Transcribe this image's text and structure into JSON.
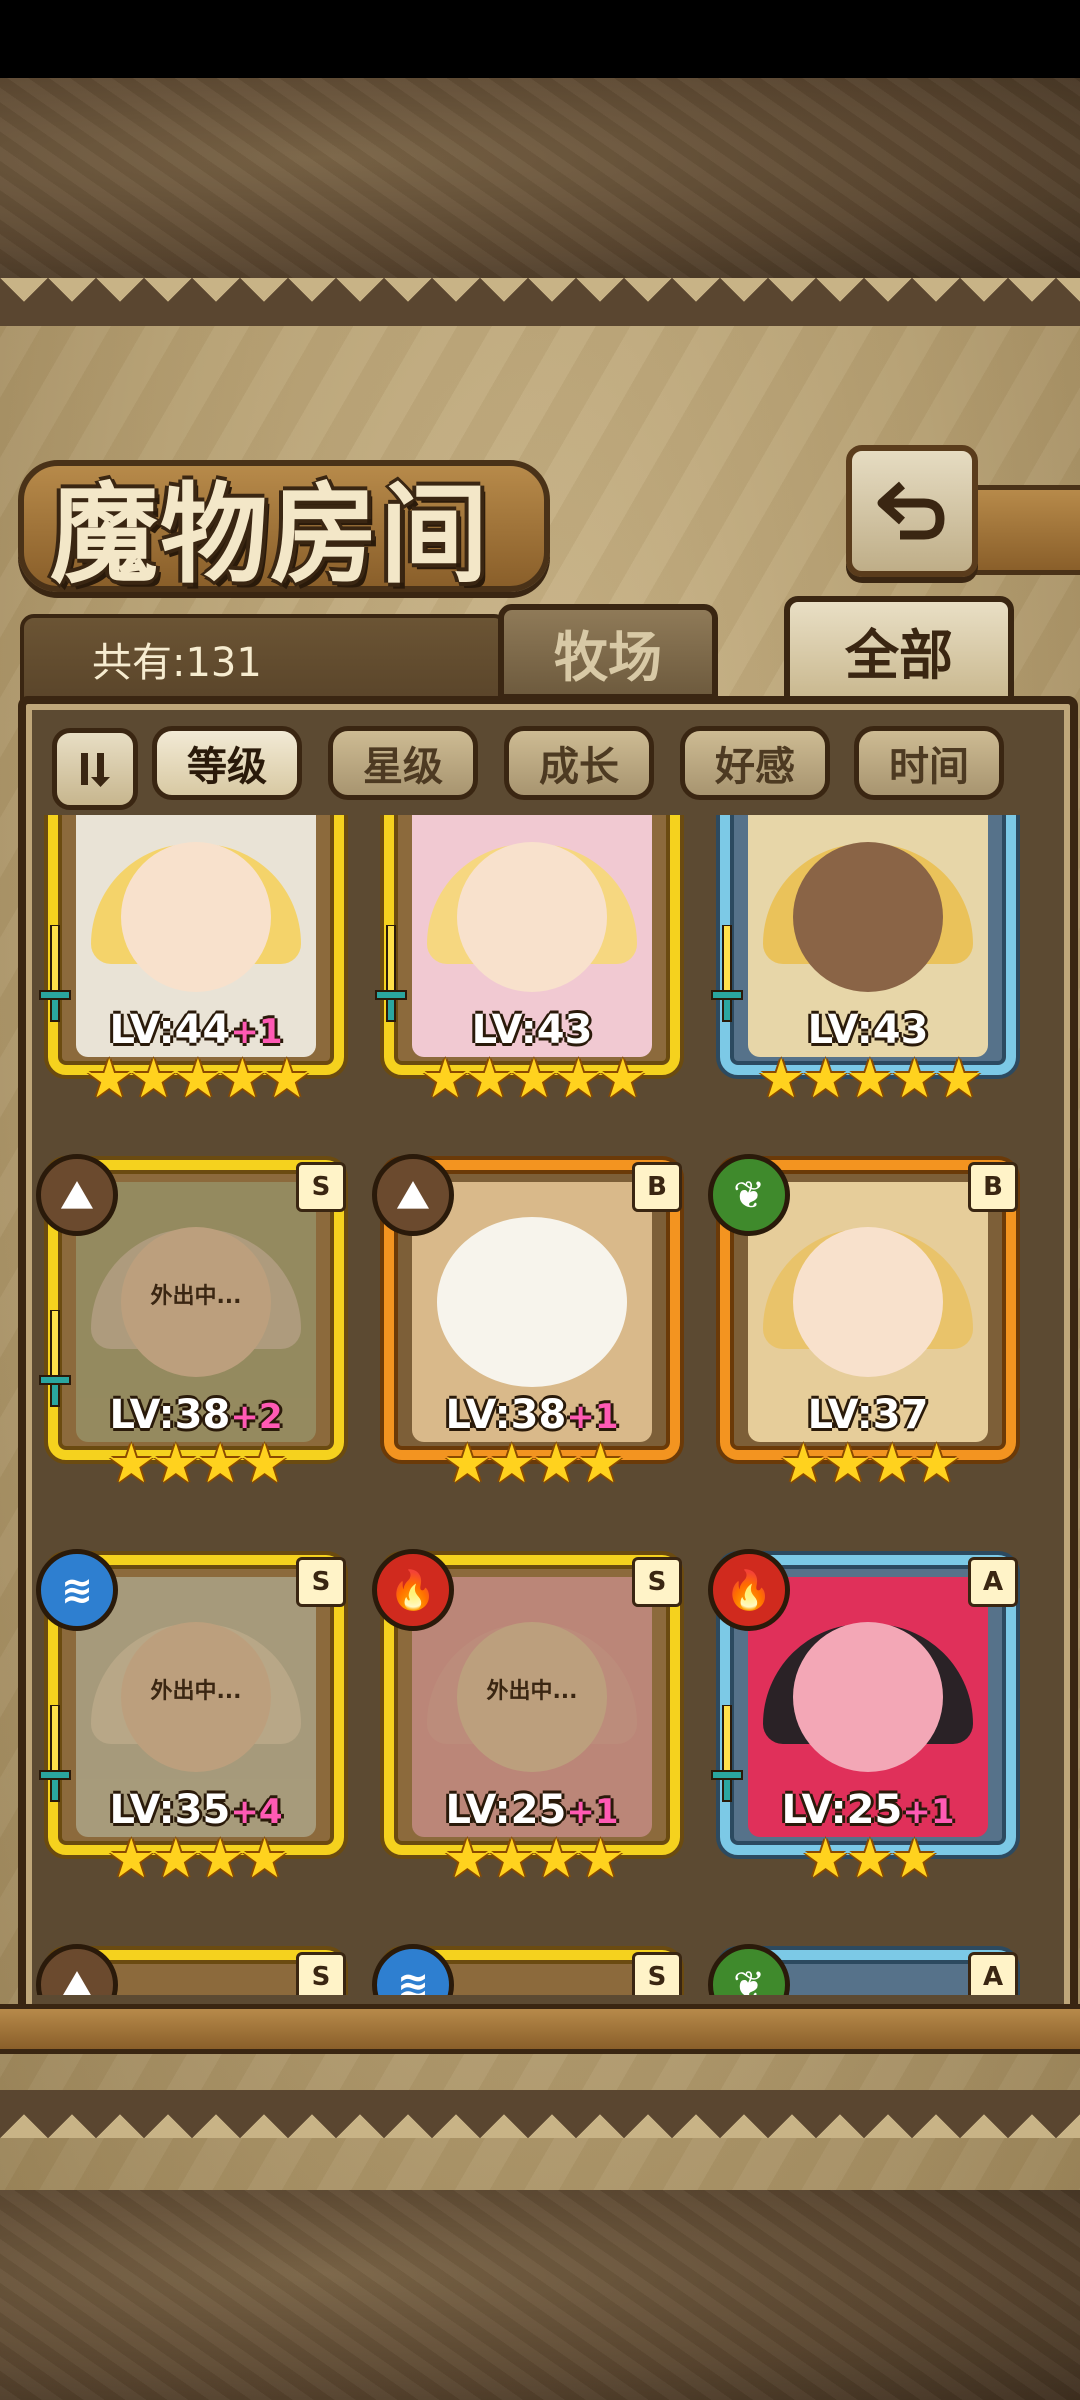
{
  "screen": {
    "title": "魔物房间",
    "count_label": "共有:131",
    "tabs": [
      {
        "label": "牧场",
        "active": false
      },
      {
        "label": "全部",
        "active": true
      }
    ],
    "filters": [
      {
        "label": "等级",
        "active": true
      },
      {
        "label": "星级",
        "active": false
      },
      {
        "label": "成长",
        "active": false
      },
      {
        "label": "好感",
        "active": false
      },
      {
        "label": "时间",
        "active": false
      }
    ]
  },
  "monsters": [
    {
      "level": "LV:44",
      "bonus": "+1",
      "stars": "★★★★★",
      "rarity": "",
      "element": "",
      "frame": "gold",
      "outing": ""
    },
    {
      "level": "LV:43",
      "bonus": "",
      "stars": "★★★★★",
      "rarity": "",
      "element": "",
      "frame": "gold",
      "outing": ""
    },
    {
      "level": "LV:43",
      "bonus": "",
      "stars": "★★★★★",
      "rarity": "",
      "element": "",
      "frame": "blue",
      "outing": ""
    },
    {
      "level": "LV:38",
      "bonus": "+2",
      "stars": "★★★★",
      "rarity": "S",
      "element": "earth",
      "frame": "gold",
      "outing": "外出中..."
    },
    {
      "level": "LV:38",
      "bonus": "+1",
      "stars": "★★★★",
      "rarity": "B",
      "element": "earth",
      "frame": "orange",
      "outing": ""
    },
    {
      "level": "LV:37",
      "bonus": "",
      "stars": "★★★★",
      "rarity": "B",
      "element": "wood",
      "frame": "orange",
      "outing": ""
    },
    {
      "level": "LV:35",
      "bonus": "+4",
      "stars": "★★★★",
      "rarity": "S",
      "element": "water",
      "frame": "gold",
      "outing": "外出中..."
    },
    {
      "level": "LV:25",
      "bonus": "+1",
      "stars": "★★★★",
      "rarity": "S",
      "element": "fire",
      "frame": "gold",
      "outing": "外出中..."
    },
    {
      "level": "LV:25",
      "bonus": "+1",
      "stars": "★★★",
      "rarity": "A",
      "element": "fire",
      "frame": "blue",
      "outing": ""
    },
    {
      "level": "",
      "bonus": "",
      "stars": "",
      "rarity": "S",
      "element": "earth",
      "frame": "gold",
      "outing": ""
    },
    {
      "level": "",
      "bonus": "",
      "stars": "",
      "rarity": "S",
      "element": "water",
      "frame": "gold",
      "outing": ""
    },
    {
      "level": "",
      "bonus": "",
      "stars": "",
      "rarity": "A",
      "element": "wood",
      "frame": "blue",
      "outing": ""
    }
  ],
  "colors": {
    "accent_gold": "#f5d21e",
    "accent_orange": "#f39420",
    "accent_blue": "#7cc9e6",
    "level_bonus": "#ff5ab4"
  }
}
